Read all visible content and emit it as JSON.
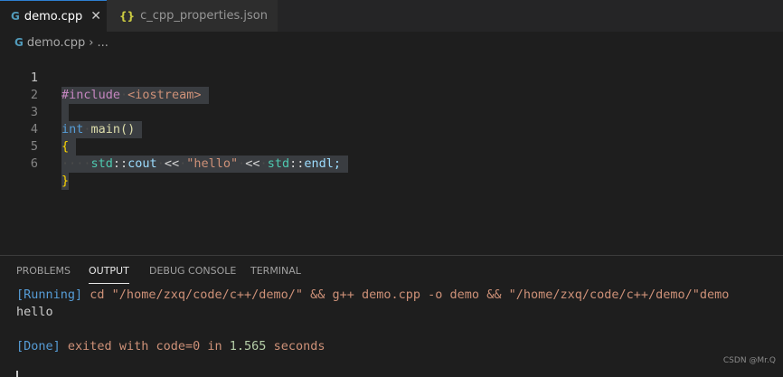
{
  "tabs": [
    {
      "label": "demo.cpp",
      "icon": "cpp-file-icon",
      "active": true
    },
    {
      "label": "c_cpp_properties.json",
      "icon": "json-file-icon",
      "active": false
    }
  ],
  "breadcrumb": {
    "file": "demo.cpp",
    "rest": "..."
  },
  "code_lines": [
    {
      "num": "1",
      "tokens": [
        "#include",
        "<iostream>"
      ]
    },
    {
      "num": "2",
      "tokens": []
    },
    {
      "num": "3",
      "tokens": [
        "int",
        "main()"
      ]
    },
    {
      "num": "4",
      "tokens": [
        "{"
      ]
    },
    {
      "num": "5",
      "tokens": [
        "std",
        "::",
        "cout",
        "<<",
        "\"hello\"",
        "<<",
        "std",
        "::",
        "endl;"
      ]
    },
    {
      "num": "6",
      "tokens": [
        "}"
      ]
    }
  ],
  "panel": {
    "tabs": [
      "PROBLEMS",
      "OUTPUT",
      "DEBUG CONSOLE",
      "TERMINAL"
    ],
    "active_tab": "OUTPUT",
    "output": {
      "running_tag": "[Running]",
      "command": "cd \"/home/zxq/code/c++/demo/\" && g++ demo.cpp -o demo && \"/home/zxq/code/c++/demo/\"demo",
      "program_output": "hello",
      "done_tag": "[Done]",
      "done_text_1": "exited with",
      "done_code": "code=0",
      "done_text_2": "in",
      "done_time": "1.565",
      "done_text_3": "seconds"
    }
  },
  "watermark": "CSDN @Mr.Q",
  "colors": {
    "accent": "#2d7fd1",
    "background": "#1e1e1e",
    "selection": "#3a3d41"
  }
}
